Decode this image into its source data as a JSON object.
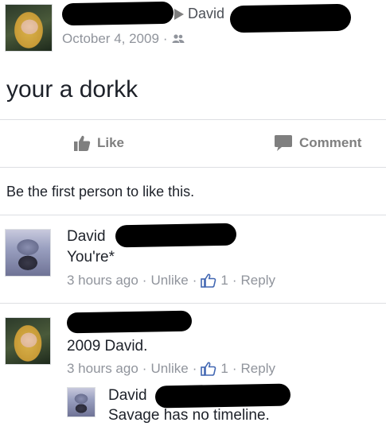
{
  "post": {
    "author_to": "David",
    "date": "October 4, 2009",
    "separator": "·",
    "audience_icon": "friends-icon",
    "text": "your a dorkk"
  },
  "actions": {
    "like_label": "Like",
    "comment_label": "Comment"
  },
  "likes_prompt": "Be the first person to like this.",
  "comments": [
    {
      "author": "David",
      "text": "You're*",
      "time": "3 hours ago",
      "unlike_label": "Unlike",
      "like_count": "1",
      "reply_label": "Reply"
    },
    {
      "author": "",
      "text": "2009 David.",
      "time": "3 hours ago",
      "unlike_label": "Unlike",
      "like_count": "1",
      "reply_label": "Reply"
    }
  ],
  "reply": {
    "author": "David",
    "text": "Savage has no timeline."
  },
  "meta_separator": "·",
  "colors": {
    "link": "#4267b2",
    "muted": "#90949c",
    "divider": "#dddfe2",
    "redaction": "#000000"
  }
}
